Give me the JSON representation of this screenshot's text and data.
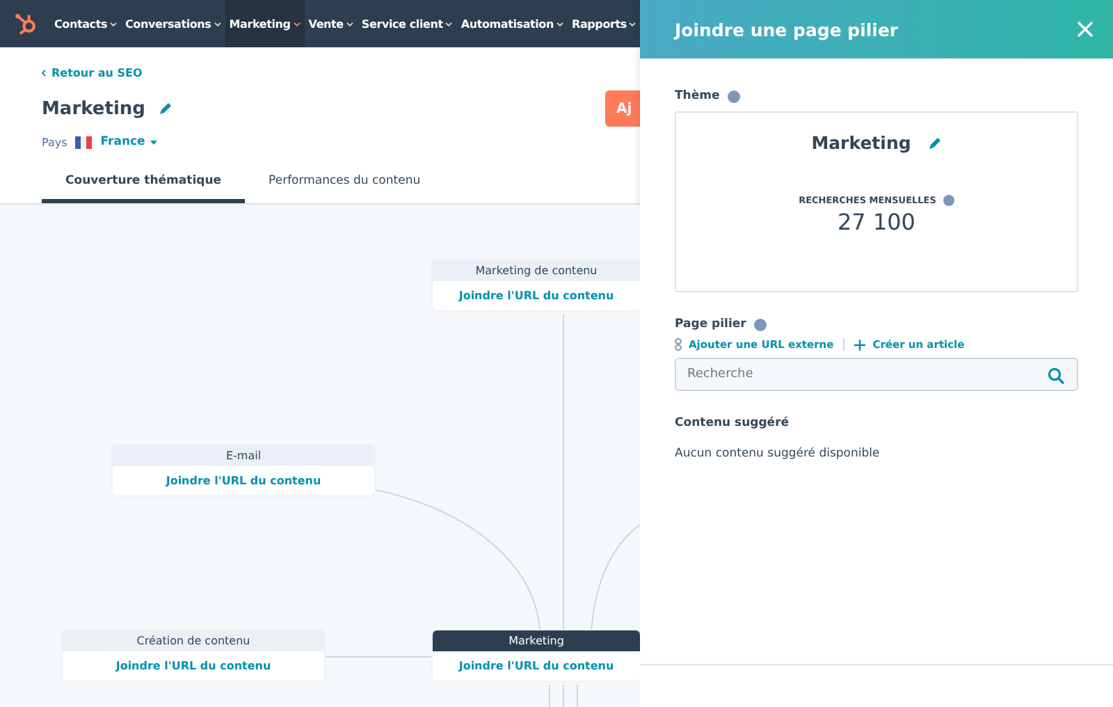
{
  "nav": {
    "items": [
      {
        "label": "Contacts",
        "selected": false
      },
      {
        "label": "Conversations",
        "selected": false
      },
      {
        "label": "Marketing",
        "selected": true
      },
      {
        "label": "Vente",
        "selected": false
      },
      {
        "label": "Service client",
        "selected": false
      },
      {
        "label": "Automatisation",
        "selected": false
      },
      {
        "label": "Rapports",
        "selected": false
      }
    ]
  },
  "page": {
    "back_link": "Retour au SEO",
    "title": "Marketing",
    "country_label": "Pays",
    "country": "France",
    "action_button": "Aj"
  },
  "tabs": [
    {
      "label": "Couverture thématique",
      "selected": true
    },
    {
      "label": "Performances du contenu",
      "selected": false
    }
  ],
  "nodes": [
    {
      "title": "Marketing de contenu",
      "link": "Joindre l'URL du contenu",
      "pillar": false
    },
    {
      "title": "E-mail",
      "link": "Joindre l'URL du contenu",
      "pillar": false
    },
    {
      "title": "Création de contenu",
      "link": "Joindre l'URL du contenu",
      "pillar": false
    },
    {
      "title": "Marketing",
      "link": "Joindre l'URL du contenu",
      "pillar": true
    }
  ],
  "drawer": {
    "title": "Joindre une page pilier",
    "theme_label": "Thème",
    "theme": "Marketing",
    "searches_label": "RECHERCHES MENSUELLES",
    "searches": "27 100",
    "pillar_label": "Page pilier",
    "add_url": "Ajouter une URL externe",
    "create_article": "Créer un article",
    "search": {
      "placeholder": "Recherche"
    },
    "suggested_label": "Contenu suggéré",
    "suggested_empty": "Aucun contenu suggéré disponible"
  }
}
